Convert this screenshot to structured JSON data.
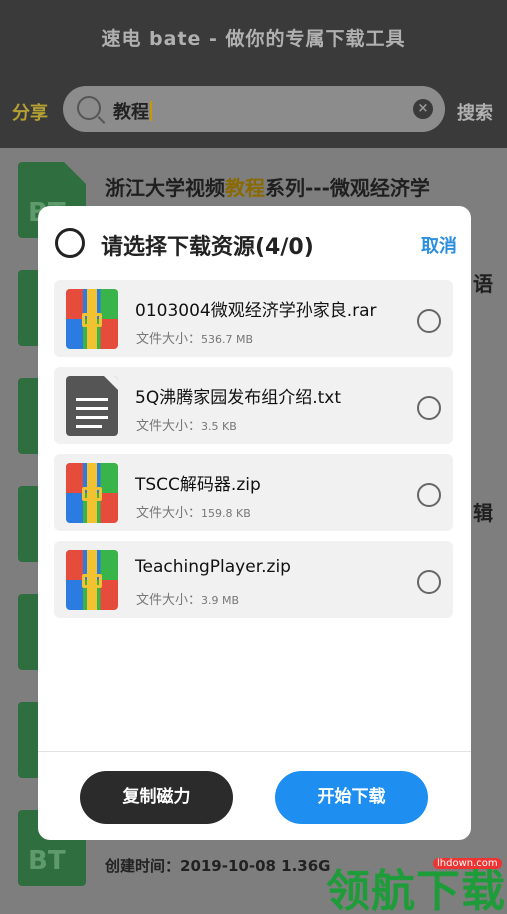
{
  "app": {
    "title": "速电 bate - 做你的专属下载工具",
    "share_label": "分享",
    "search_value": "教程",
    "search_button": "搜索"
  },
  "background": {
    "row1_title_prefix": "浙江大学视频",
    "row1_title_highlight": "教程",
    "row1_title_suffix": "系列---微观经济学",
    "side_text_1": "语",
    "side_text_2": "辑",
    "meta": "创建时间：2019-10-08  1.36G",
    "bt_label": "BT"
  },
  "dialog": {
    "title": "请选择下载资源(4/0)",
    "cancel_label": "取消",
    "files": [
      {
        "name": "0103004微观经济学孙家良.rar",
        "size_label": "文件大小：",
        "size": "536.7 MB",
        "type": "rar"
      },
      {
        "name": "5Q沸腾家园发布组介绍.txt",
        "size_label": "文件大小：",
        "size": "3.5 KB",
        "type": "txt"
      },
      {
        "name": "TSCC解码器.zip",
        "size_label": "文件大小：",
        "size": "159.8 KB",
        "type": "zip"
      },
      {
        "name": "TeachingPlayer.zip",
        "size_label": "文件大小：",
        "size": "3.9 MB",
        "type": "zip"
      }
    ],
    "copy_button": "复制磁力",
    "start_button": "开始下载"
  },
  "watermark": {
    "text": "领航下载",
    "url": "lhdown.com"
  },
  "colors": {
    "accent_blue": "#1e8ff0",
    "cancel_blue": "#2b8fe0",
    "dark_button": "#2b2b2b",
    "highlight_gold": "#c49a00"
  }
}
